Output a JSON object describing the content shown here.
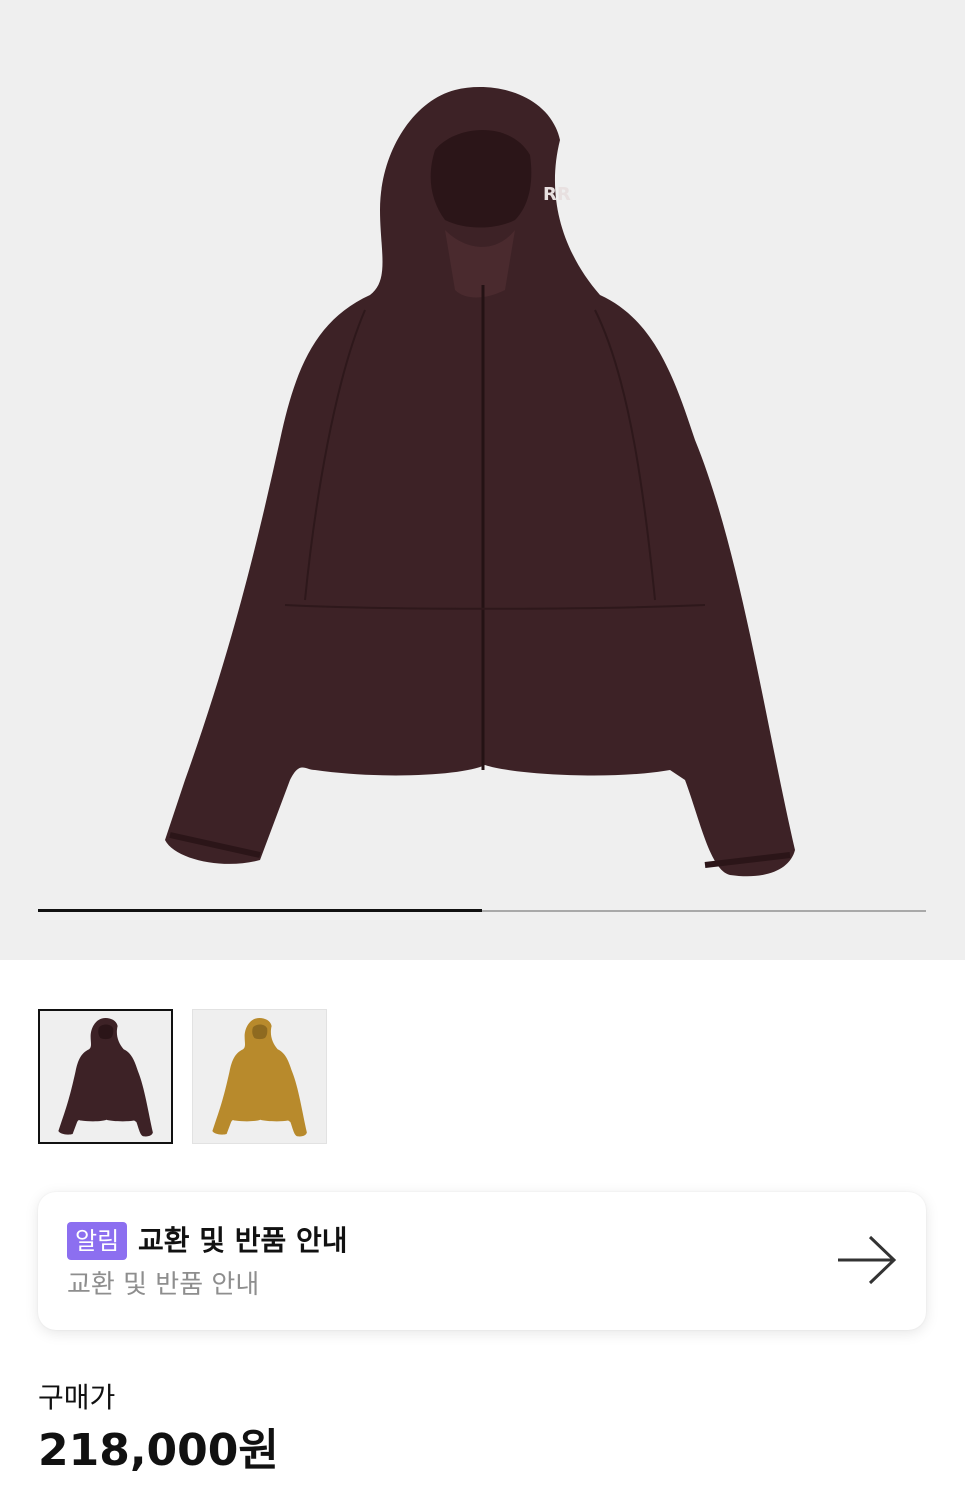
{
  "gallery": {
    "current_image_fraction": 0.5,
    "main_image_icon": "jacket-photo",
    "thumbnails": [
      {
        "icon": "jacket-thumbnail",
        "color": "#3d2226",
        "selected": true
      },
      {
        "icon": "jacket-thumbnail",
        "color": "#b88a2c",
        "selected": false
      }
    ]
  },
  "notice": {
    "badge": "알림",
    "title": "교환 및 반품 안내",
    "subtitle": "교환 및 반품 안내",
    "badge_color": "#8c6ff0",
    "arrow_icon": "arrow-right-icon"
  },
  "price": {
    "label": "구매가",
    "value": "218,000원"
  }
}
